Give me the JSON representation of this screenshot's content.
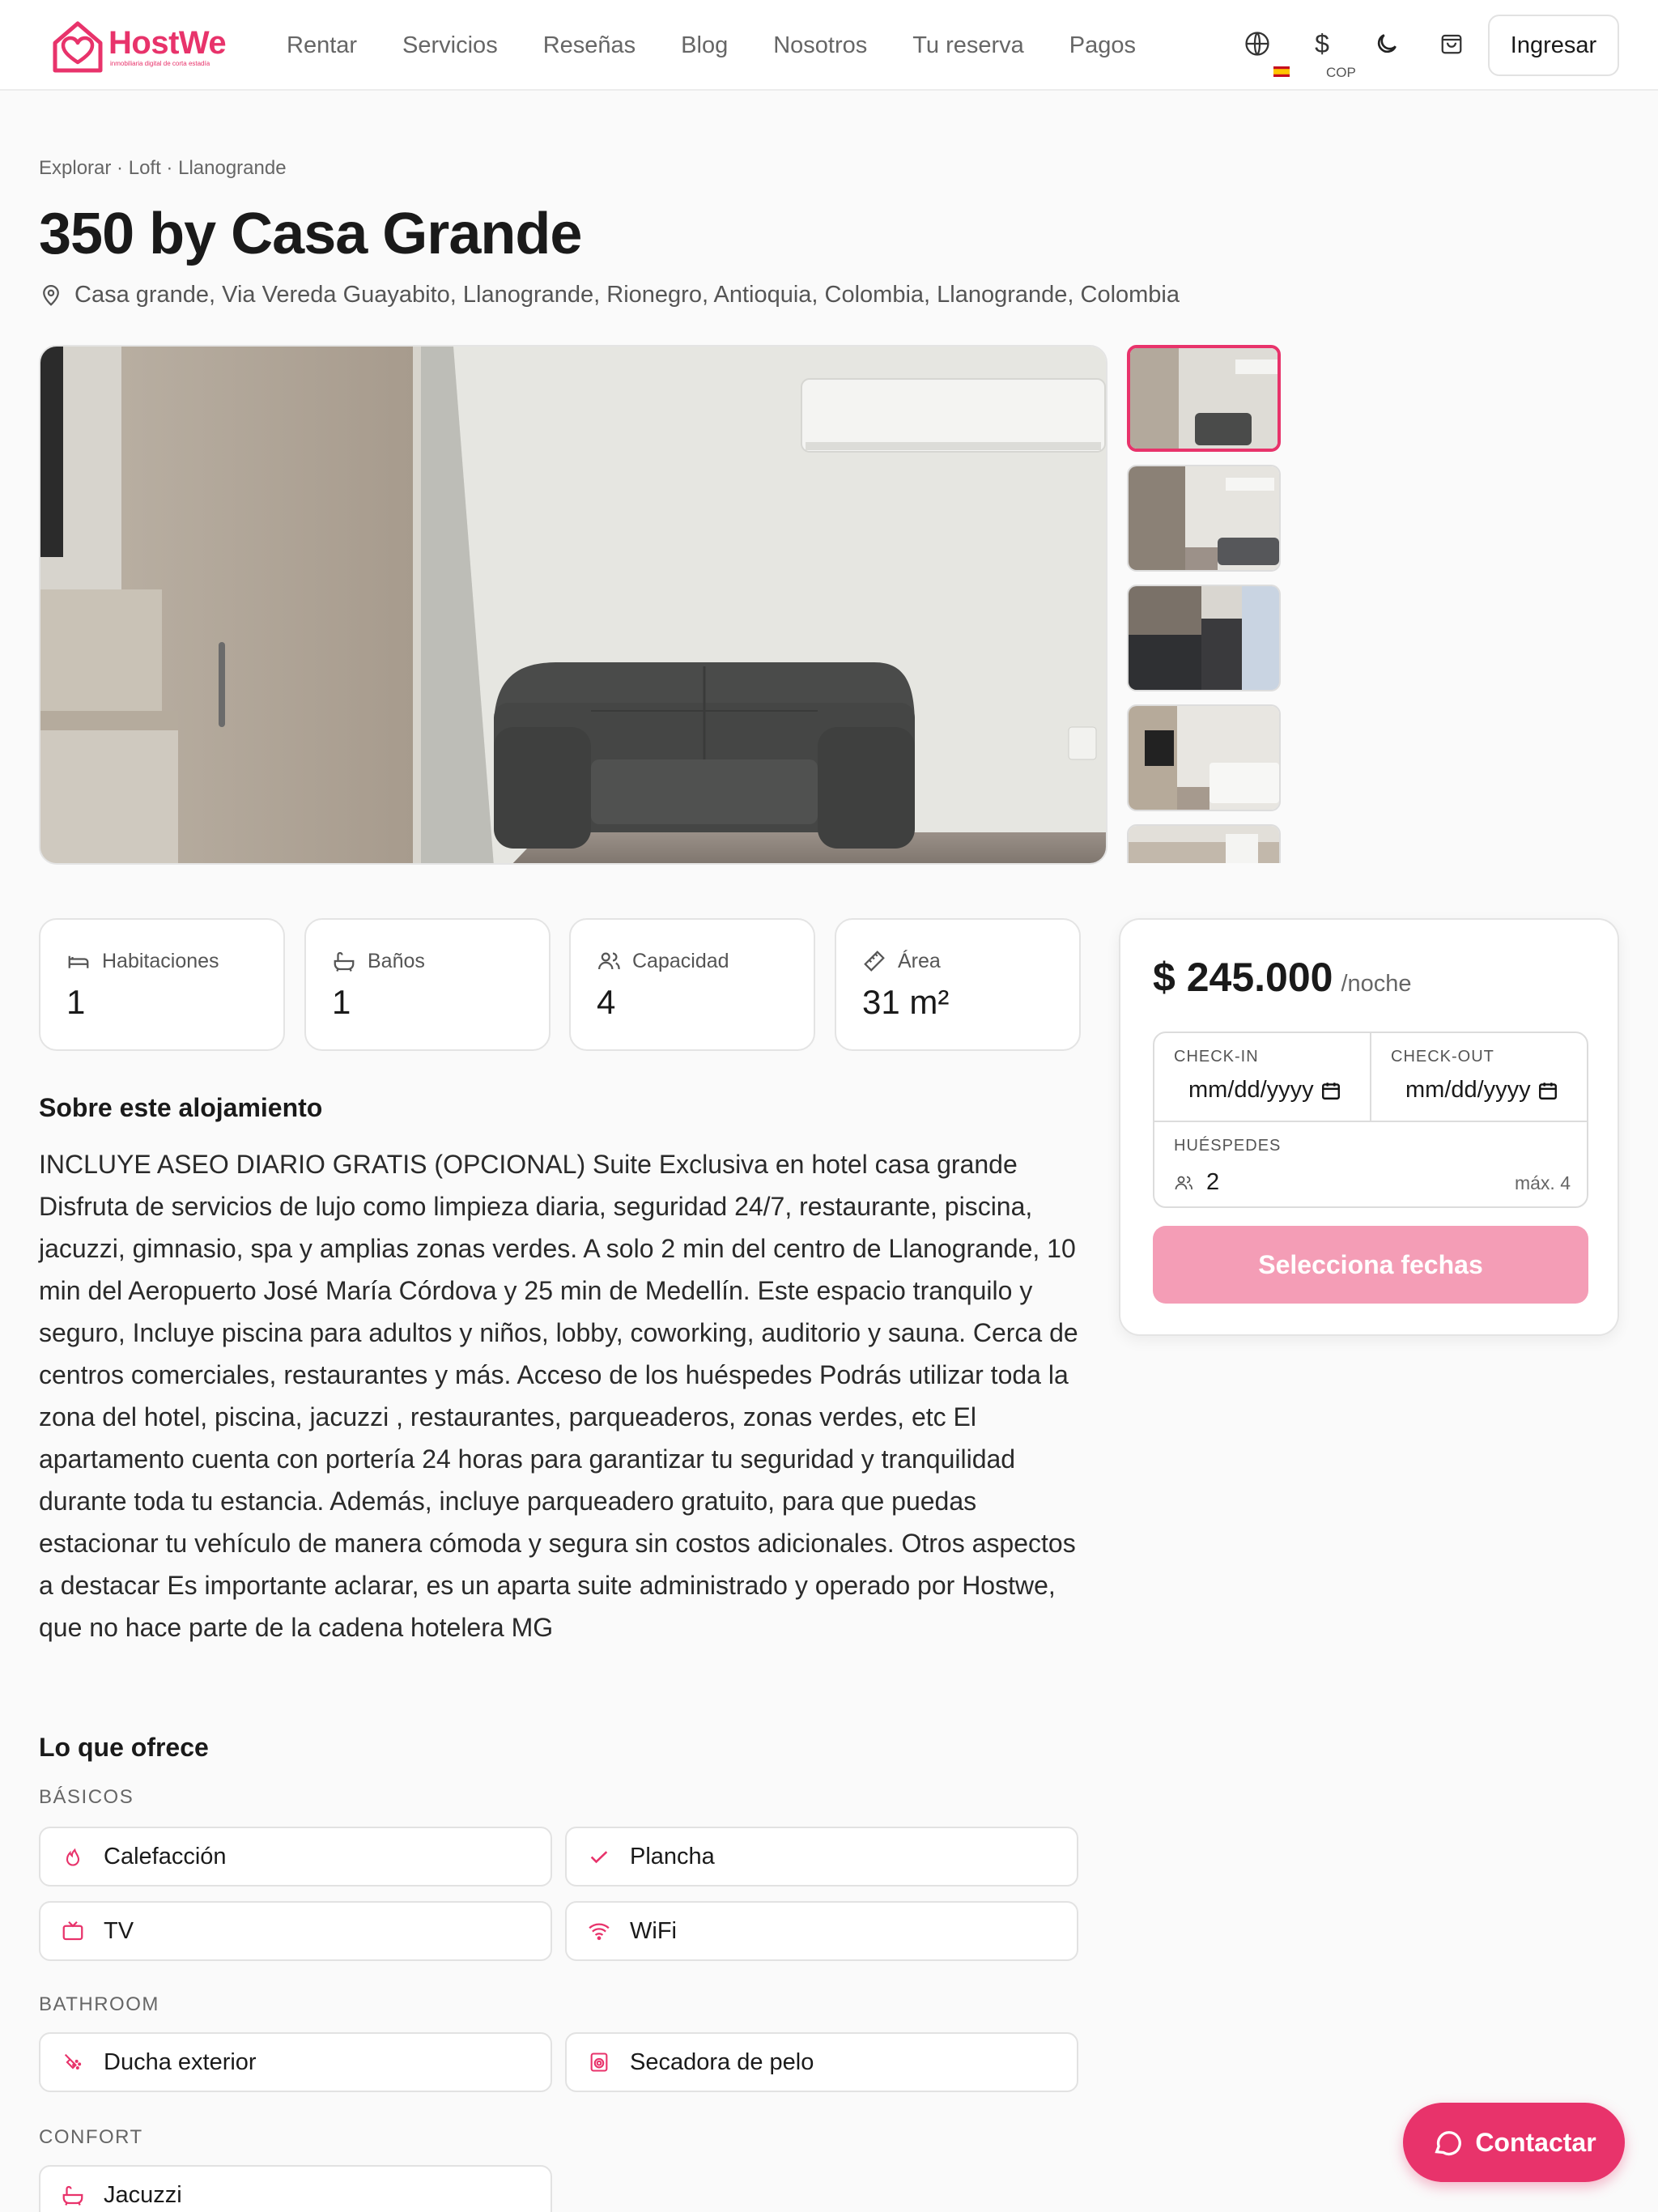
{
  "header": {
    "brand": "HostWe",
    "tagline": "inmobiliaria digital de corta estadía",
    "nav": [
      "Rentar",
      "Servicios",
      "Reseñas",
      "Blog",
      "Nosotros",
      "Tu reserva",
      "Pagos"
    ],
    "currency": "COP",
    "login_label": "Ingresar"
  },
  "listing": {
    "breadcrumb": [
      "Explorar",
      "Loft",
      "Llanogrande"
    ],
    "title": "350 by Casa Grande",
    "address": "Casa grande, Via Vereda Guayabito, Llanogrande, Rionegro, Antioquia, Colombia, Llanogrande, Colombia",
    "stats": [
      {
        "label": "Habitaciones",
        "value": "1",
        "icon": "bed-icon"
      },
      {
        "label": "Baños",
        "value": "1",
        "icon": "bath-icon"
      },
      {
        "label": "Capacidad",
        "value": "4",
        "icon": "users-icon"
      },
      {
        "label": "Área",
        "value": "31 m²",
        "icon": "ruler-icon"
      }
    ]
  },
  "about": {
    "heading": "Sobre este alojamiento",
    "text": "INCLUYE ASEO DIARIO GRATIS (OPCIONAL) Suite Exclusiva en hotel casa grande Disfruta de servicios de lujo como limpieza diaria, seguridad 24/7, restaurante, piscina, jacuzzi, gimnasio, spa y amplias zonas verdes. A solo 2 min del centro de Llanogrande, 10 min del Aeropuerto José María Córdova y 25 min de Medellín. Este espacio tranquilo y seguro, Incluye piscina para adultos y niños, lobby, coworking, auditorio y sauna. Cerca de centros comerciales, restaurantes y más. Acceso de los huéspedes Podrás utilizar toda la zona del hotel, piscina, jacuzzi , restaurantes, parqueaderos, zonas verdes, etc El apartamento cuenta con portería 24 horas para garantizar tu seguridad y tranquilidad durante toda tu estancia. Además, incluye parqueadero gratuito, para que puedas estacionar tu vehículo de manera cómoda y segura sin costos adicionales. Otros aspectos a destacar Es importante aclarar, es un aparta suite administrado y operado por Hostwe, que no hace parte de la cadena hotelera MG"
  },
  "amenities": {
    "heading": "Lo que ofrece",
    "categories": [
      {
        "name": "BÁSICOS",
        "items": [
          {
            "label": "Calefacción",
            "icon": "flame-icon"
          },
          {
            "label": "Plancha",
            "icon": "check-icon"
          },
          {
            "label": "TV",
            "icon": "tv-icon"
          },
          {
            "label": "WiFi",
            "icon": "wifi-icon"
          }
        ]
      },
      {
        "name": "BATHROOM",
        "items": [
          {
            "label": "Ducha exterior",
            "icon": "shower-icon"
          },
          {
            "label": "Secadora de pelo",
            "icon": "dryer-icon"
          }
        ]
      },
      {
        "name": "CONFORT",
        "items": [
          {
            "label": "Jacuzzi",
            "icon": "bathtub-icon"
          }
        ]
      }
    ]
  },
  "booking": {
    "price": "$ 245.000",
    "unit": "/noche",
    "checkin_label": "CHECK-IN",
    "checkout_label": "CHECK-OUT",
    "date_placeholder": "mm/dd/yyyy",
    "guests_label": "HUÉSPEDES",
    "guests_value": "2",
    "guests_max": "máx. 4",
    "cta": "Selecciona fechas"
  },
  "contact_label": "Contactar",
  "colors": {
    "accent": "#e8336b",
    "cta_disabled": "#f49db6"
  }
}
